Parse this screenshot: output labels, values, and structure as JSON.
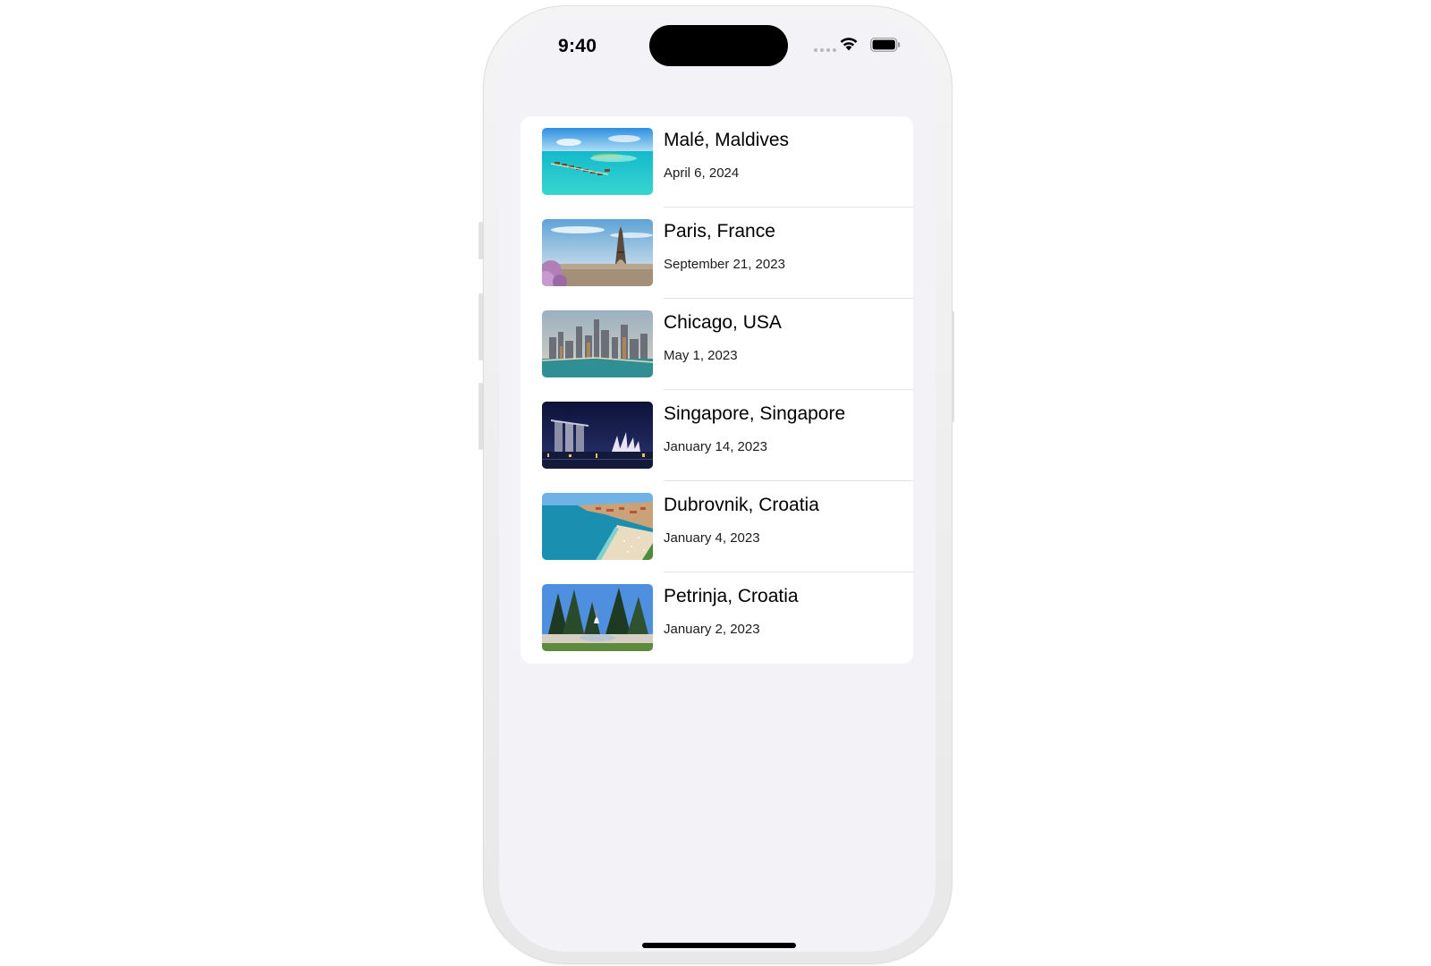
{
  "status_bar": {
    "time": "9:40",
    "icons": [
      "signal-dots-icon",
      "wifi-icon",
      "battery-icon"
    ]
  },
  "trips": [
    {
      "title": "Malé, Maldives",
      "date": "April 6, 2024",
      "image": "maldives-photo"
    },
    {
      "title": "Paris, France",
      "date": "September 21, 2023",
      "image": "paris-photo"
    },
    {
      "title": "Chicago, USA",
      "date": "May 1, 2023",
      "image": "chicago-photo"
    },
    {
      "title": "Singapore, Singapore",
      "date": "January 14, 2023",
      "image": "singapore-photo"
    },
    {
      "title": "Dubrovnik, Croatia",
      "date": "January 4, 2023",
      "image": "dubrovnik-photo"
    },
    {
      "title": "Petrinja, Croatia",
      "date": "January 2, 2023",
      "image": "petrinja-photo"
    }
  ],
  "colors": {
    "screen_background": "#f2f2f7",
    "card_background": "#ffffff",
    "separator": "#e3e3e6",
    "text": "#000000"
  }
}
